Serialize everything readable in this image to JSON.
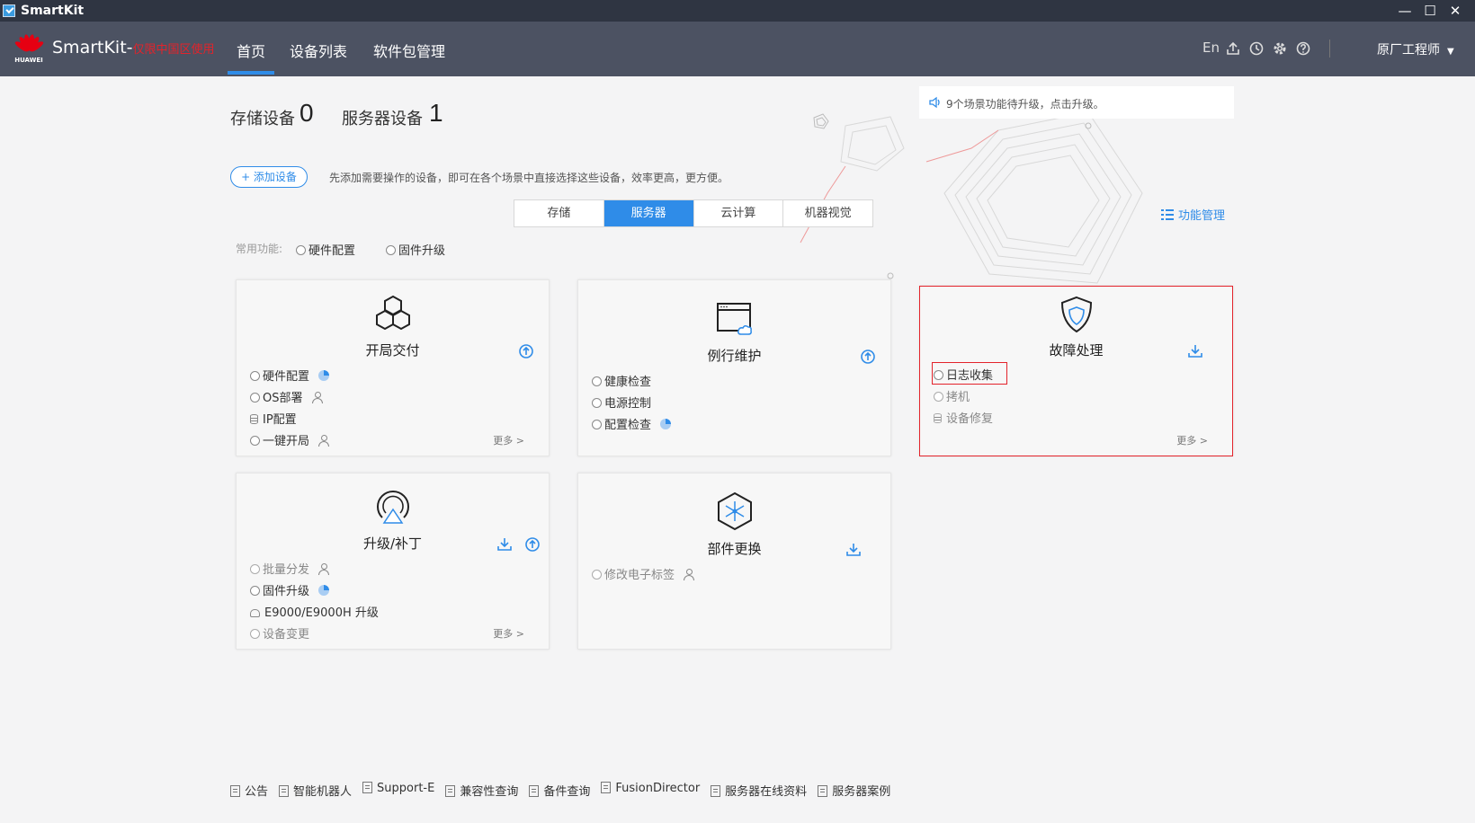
{
  "titlebar": {
    "title": "SmartKit",
    "min": "—",
    "max": "☐",
    "close": "✕"
  },
  "nav": {
    "brand": "HUAWEI",
    "app_name": "SmartKit-",
    "app_suffix": "仅限中国区使用",
    "tabs": [
      "首页",
      "设备列表",
      "软件包管理"
    ],
    "active_tab": "首页",
    "lang": "En",
    "user": "原厂工程师"
  },
  "counts": {
    "storage_label": "存储设备",
    "storage_value": "0",
    "server_label": "服务器设备",
    "server_value": "1"
  },
  "add_device": {
    "label": "+ 添加设备",
    "hint": "先添加需要操作的设备，即可在各个场景中直接选择这些设备，效率更高，更方便。"
  },
  "notice": "9个场景功能待升级，点击升级。",
  "segments": [
    "存储",
    "服务器",
    "云计算",
    "机器视觉"
  ],
  "active_segment": "服务器",
  "func_mgmt": "功能管理",
  "common": {
    "label": "常用功能:",
    "items": [
      "硬件配置",
      "固件升级"
    ]
  },
  "cards": {
    "kaiju": {
      "title": "开局交付",
      "items": [
        "硬件配置",
        "OS部署",
        "IP配置",
        "一键开局"
      ],
      "more": "更多 >"
    },
    "lixing": {
      "title": "例行维护",
      "items": [
        "健康检查",
        "电源控制",
        "配置检查"
      ]
    },
    "guzhang": {
      "title": "故障处理",
      "items": [
        "日志收集",
        "拷机",
        "设备修复"
      ],
      "more": "更多 >"
    },
    "shengji": {
      "title": "升级/补丁",
      "items": [
        "批量分发",
        "固件升级",
        "E9000/E9000H 升级",
        "设备变更"
      ],
      "more": "更多 >"
    },
    "bujian": {
      "title": "部件更换",
      "items": [
        "修改电子标签"
      ]
    }
  },
  "footer": [
    "公告",
    "智能机器人",
    "Support-E",
    "兼容性查询",
    "备件查询",
    "FusionDirector",
    "服务器在线资料",
    "服务器案例"
  ],
  "colors": {
    "accent": "#2f8ce8",
    "nav_bg": "#4c5262",
    "titlebar_bg": "#2f3542",
    "highlight": "#e3232b"
  }
}
